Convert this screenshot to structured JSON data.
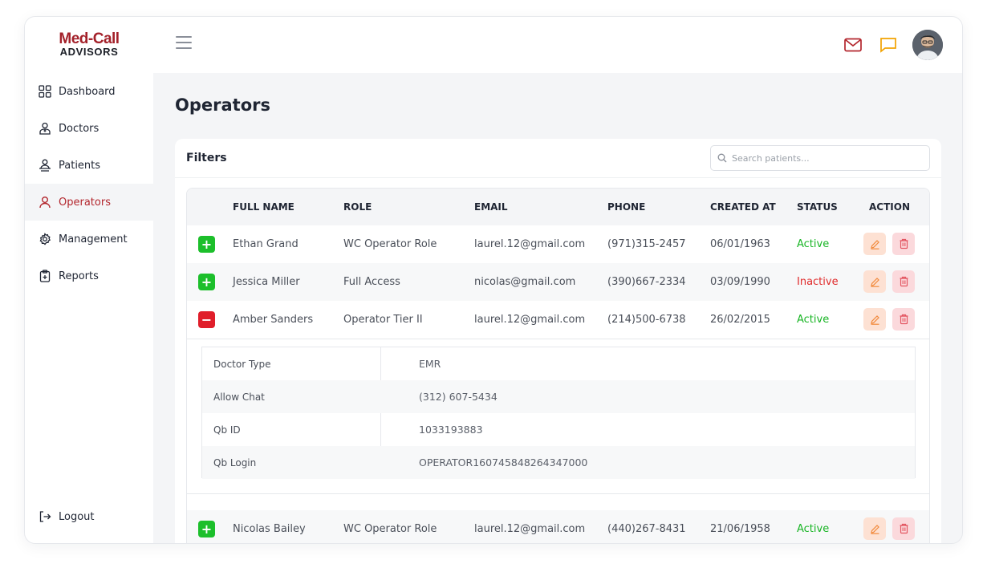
{
  "brand": {
    "line1": "Med-Call",
    "line2": "ADVISORS",
    "color": "#a3212a"
  },
  "sidebar": {
    "items": [
      {
        "label": "Dashboard",
        "icon": "grid-icon"
      },
      {
        "label": "Doctors",
        "icon": "doctor-icon"
      },
      {
        "label": "Patients",
        "icon": "patient-icon"
      },
      {
        "label": "Operators",
        "icon": "user-icon",
        "active": true
      },
      {
        "label": "Management",
        "icon": "gear-icon"
      },
      {
        "label": "Reports",
        "icon": "clipboard-icon"
      }
    ],
    "logout": "Logout"
  },
  "header": {
    "icons": [
      "mail-icon",
      "chat-icon"
    ],
    "avatar": "avatar"
  },
  "page": {
    "title": "Operators"
  },
  "filters": {
    "label": "Filters",
    "search_placeholder": "Search patients..."
  },
  "table": {
    "columns": [
      "FULL NAME",
      "ROLE",
      "EMAIL",
      "PHONE",
      "CREATED AT",
      "STATUS",
      "ACTION"
    ],
    "rows": [
      {
        "name": "Ethan Grand",
        "role": "WC Operator Role",
        "email": "laurel.12@gmail.com",
        "phone": "(971)315-2457",
        "created": "06/01/1963",
        "status": "Active",
        "expanded": false
      },
      {
        "name": "Jessica Miller",
        "role": "Full Access",
        "email": "nicolas@gmail.com",
        "phone": "(390)667-2334",
        "created": "03/09/1990",
        "status": "Inactive",
        "expanded": false
      },
      {
        "name": "Amber Sanders",
        "role": "Operator Tier II",
        "email": "laurel.12@gmail.com",
        "phone": "(214)500-6738",
        "created": "26/02/2015",
        "status": "Active",
        "expanded": true
      },
      {
        "name": "Nicolas Bailey",
        "role": "WC Operator Role",
        "email": "laurel.12@gmail.com",
        "phone": "(440)267-8431",
        "created": "21/06/1958",
        "status": "Active",
        "expanded": false
      }
    ],
    "details": [
      {
        "label": "Doctor Type",
        "value": "EMR"
      },
      {
        "label": "Allow Chat",
        "value": "(312) 607-5434"
      },
      {
        "label": "Qb ID",
        "value": "1033193883"
      },
      {
        "label": "Qb Login",
        "value": "OPERATOR160745848264347000"
      }
    ]
  },
  "colors": {
    "accent": "#b3262d",
    "active": "#18b524",
    "inactive": "#e02a2a",
    "plus": "#1cbf2b",
    "minus": "#e01e2a",
    "chat": "#f2a300"
  }
}
